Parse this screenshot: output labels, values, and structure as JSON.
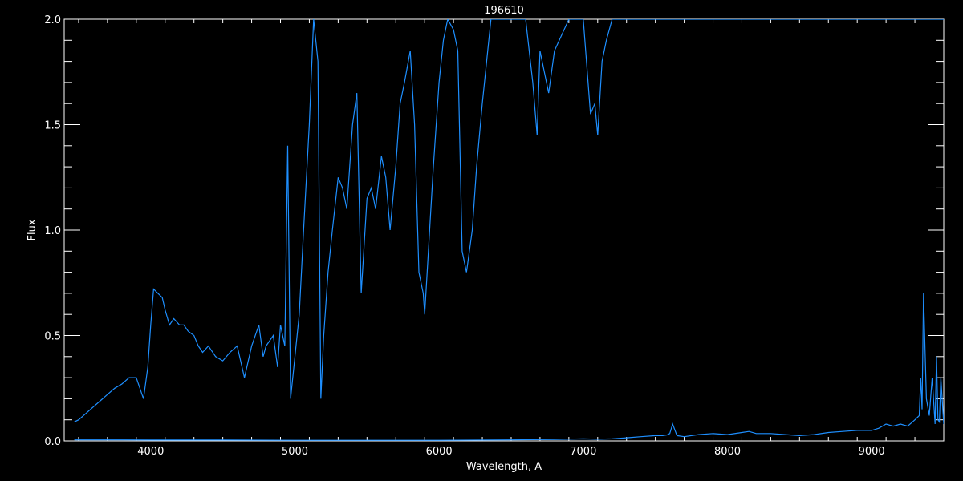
{
  "chart_data": {
    "type": "line",
    "title": "196610",
    "xlabel": "Wavelength, A",
    "ylabel": "Flux",
    "xlim": [
      3400,
      9500
    ],
    "ylim": [
      0.0,
      2.0
    ],
    "x_ticks": [
      {
        "value": 4000,
        "label": "4000"
      },
      {
        "value": 5000,
        "label": "5000"
      },
      {
        "value": 6000,
        "label": "6000"
      },
      {
        "value": 7000,
        "label": "7000"
      },
      {
        "value": 8000,
        "label": "8000"
      },
      {
        "value": 9000,
        "label": "9000"
      }
    ],
    "y_ticks": [
      {
        "value": 0.0,
        "label": "0.0"
      },
      {
        "value": 0.5,
        "label": "0.5"
      },
      {
        "value": 1.0,
        "label": "1.0"
      },
      {
        "value": 1.5,
        "label": "1.5"
      },
      {
        "value": 2.0,
        "label": "2.0"
      }
    ],
    "grid": false,
    "colors": {
      "background": "#000000",
      "axes": "#ffffff",
      "series": "#1e8fff"
    },
    "series": [
      {
        "x": [
          3470,
          3500,
          3550,
          3600,
          3650,
          3700,
          3750,
          3800,
          3850,
          3900,
          3950,
          3980,
          4000,
          4020,
          4050,
          4080,
          4100,
          4130,
          4160,
          4200,
          4230,
          4260,
          4300,
          4330,
          4360,
          4400,
          4450,
          4500,
          4550,
          4600,
          4650,
          4700,
          4750,
          4780,
          4800,
          4850,
          4880,
          4900,
          4930,
          4950,
          4970,
          5000,
          5030,
          5060,
          5100,
          5130,
          5160,
          5180,
          5200,
          5230,
          5260,
          5300,
          5330,
          5360,
          5400,
          5430,
          5460,
          5500,
          5530,
          5560,
          5600,
          5630,
          5660,
          5700,
          5730,
          5760,
          5800,
          5830,
          5860,
          5890,
          5900,
          5930,
          5960,
          6000,
          6030,
          6060,
          6100,
          6130,
          6160,
          6190,
          6200,
          6230,
          6260,
          6300,
          6330,
          6360,
          6400,
          6500,
          6600,
          6650,
          6680,
          6700,
          6730,
          6760,
          6800,
          6900,
          7000,
          7050,
          7080,
          7100,
          7130,
          7160,
          7200,
          7250,
          7300,
          7400,
          7500,
          7550,
          7600,
          7610,
          7630,
          7650,
          7700,
          7800,
          7900,
          8000,
          8100,
          8150,
          8200,
          8300,
          8400,
          8500,
          8600,
          8700,
          8800,
          8900,
          9000,
          9050,
          9100,
          9150,
          9200,
          9250,
          9300,
          9330,
          9350,
          9370,
          9400,
          9430,
          9450,
          9480,
          9500
        ],
        "y": [
          0.09,
          0.1,
          0.13,
          0.16,
          0.19,
          0.22,
          0.25,
          0.27,
          0.3,
          0.3,
          0.2,
          0.35,
          0.55,
          0.72,
          0.7,
          0.68,
          0.62,
          0.55,
          0.58,
          0.55,
          0.55,
          0.52,
          0.5,
          0.45,
          0.42,
          0.45,
          0.4,
          0.38,
          0.42,
          0.45,
          0.3,
          0.45,
          0.55,
          0.4,
          0.45,
          0.5,
          0.35,
          0.55,
          0.45,
          1.4,
          0.2,
          0.4,
          0.6,
          1.0,
          1.5,
          2.0,
          1.8,
          0.2,
          0.5,
          0.8,
          1.0,
          1.25,
          1.2,
          1.1,
          1.5,
          1.65,
          0.7,
          1.15,
          1.2,
          1.1,
          1.35,
          1.25,
          1.0,
          1.3,
          1.6,
          1.7,
          1.85,
          1.5,
          0.8,
          0.7,
          0.6,
          0.95,
          1.3,
          1.7,
          1.9,
          2.0,
          1.95,
          1.85,
          0.9,
          0.8,
          0.85,
          1.0,
          1.3,
          1.6,
          1.8,
          2.0,
          2.0,
          2.0,
          2.0,
          1.7,
          1.45,
          1.85,
          1.75,
          1.65,
          1.85,
          2.0,
          2.0,
          1.55,
          1.6,
          1.45,
          1.8,
          1.9,
          2.0,
          2.0,
          2.0,
          2.0,
          2.0,
          2.0,
          2.0,
          2.0,
          2.0,
          2.0,
          2.0,
          2.0,
          2.0,
          2.0,
          2.0,
          2.0,
          2.0,
          2.0,
          2.0,
          2.0,
          2.0,
          2.0,
          2.0,
          2.0,
          2.0,
          2.0,
          2.0,
          2.0,
          2.0,
          2.0,
          2.0,
          2.0,
          2.0,
          2.0,
          2.0,
          2.0,
          2.0,
          2.0,
          2.0
        ]
      },
      {
        "x": [
          3470,
          3600,
          3800,
          4000,
          4200,
          4500,
          5000,
          5500,
          6000,
          6500,
          6800,
          7000,
          7100,
          7200,
          7300,
          7400,
          7500,
          7550,
          7580,
          7600,
          7620,
          7650,
          7700,
          7800,
          7900,
          8000,
          8100,
          8150,
          8200,
          8300,
          8400,
          8500,
          8600,
          8700,
          8800,
          8900,
          9000,
          9050,
          9100,
          9150,
          9200,
          9250,
          9300,
          9330,
          9340,
          9350,
          9360,
          9380,
          9400,
          9420,
          9440,
          9450,
          9460,
          9470,
          9480,
          9500
        ],
        "y": [
          0.005,
          0.005,
          0.005,
          0.004,
          0.004,
          0.004,
          0.003,
          0.003,
          0.003,
          0.005,
          0.007,
          0.01,
          0.008,
          0.01,
          0.015,
          0.02,
          0.025,
          0.025,
          0.028,
          0.035,
          0.08,
          0.025,
          0.02,
          0.03,
          0.035,
          0.03,
          0.04,
          0.045,
          0.035,
          0.035,
          0.03,
          0.025,
          0.03,
          0.04,
          0.045,
          0.05,
          0.05,
          0.06,
          0.08,
          0.07,
          0.08,
          0.07,
          0.1,
          0.12,
          0.3,
          0.15,
          0.7,
          0.2,
          0.12,
          0.3,
          0.08,
          0.4,
          0.1,
          0.09,
          0.3,
          0.08
        ]
      }
    ]
  }
}
